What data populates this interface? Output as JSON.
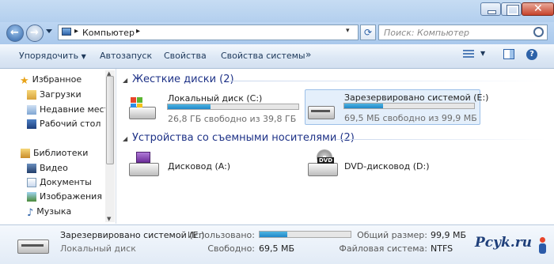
{
  "address": {
    "location": "Компьютер",
    "search_placeholder": "Поиск: Компьютер"
  },
  "toolbar": {
    "organize": "Упорядочить",
    "autoplay": "Автозапуск",
    "properties": "Свойства",
    "system_properties": "Свойства системы",
    "more": "»"
  },
  "nav": {
    "favorites": "Избранное",
    "downloads": "Загрузки",
    "recent": "Недавние места",
    "desktop": "Рабочий стол",
    "libraries": "Библиотеки",
    "video": "Видео",
    "documents": "Документы",
    "images": "Изображения",
    "music": "Музыка"
  },
  "groups": {
    "hard_drives": "Жесткие диски (2)",
    "removable": "Устройства со съемными носителями (2)"
  },
  "drives": {
    "c": {
      "name": "Локальный диск (C:)",
      "space": "26,8 ГБ свободно из 39,8 ГБ",
      "used_fraction": 0.33
    },
    "e": {
      "name": "Зарезервировано системой (E:)",
      "space": "69,5 МБ свободно из 99,9 МБ",
      "used_fraction": 0.3
    },
    "a": {
      "name": "Дисковод (A:)"
    },
    "d": {
      "name": "DVD-дисковод (D:)"
    }
  },
  "details": {
    "name": "Зарезервировано системой (E:)",
    "type": "Локальный диск",
    "used_label": "Использовано:",
    "free_label": "Свободно:",
    "free_value": "69,5 МБ",
    "total_label": "Общий размер:",
    "total_value": "99,9 МБ",
    "fs_label": "Файловая система:",
    "fs_value": "NTFS",
    "used_fraction": 0.3
  },
  "watermark": "Pcyk.ru",
  "colors": {
    "accent": "#1f86c8",
    "group_header": "#1e3287",
    "selection": "#e4effb"
  }
}
